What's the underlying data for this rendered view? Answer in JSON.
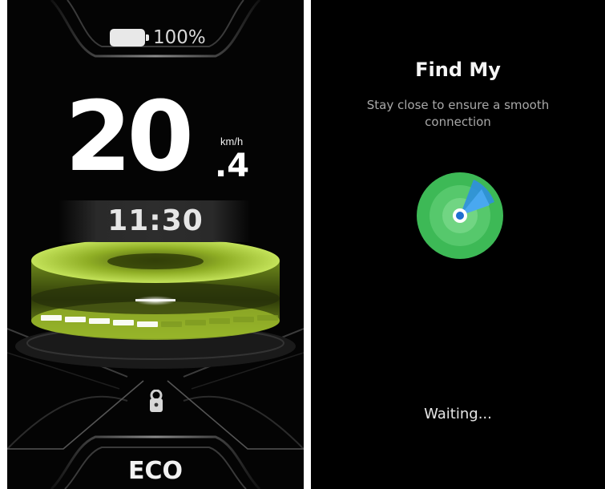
{
  "bike_display": {
    "battery_icon": "battery-full-icon",
    "battery_percent": "100%",
    "speed_integer": "20",
    "speed_decimal": ".4",
    "speed_unit": "km/h",
    "clock": "11:30",
    "lock_icon": "lock-icon",
    "ride_mode": "ECO",
    "assist_level": 0.5,
    "colors": {
      "accent_green": "#b8d94a",
      "background": "#040404",
      "text": "#ffffff"
    }
  },
  "find_my": {
    "title": "Find My",
    "subtitle": "Stay close to ensure a smooth connection",
    "radar_icon": "radar-icon",
    "status": "Waiting...",
    "colors": {
      "radar_green": "#3fbf5a",
      "radar_blue": "#2f8fe0",
      "background": "#000000"
    }
  }
}
